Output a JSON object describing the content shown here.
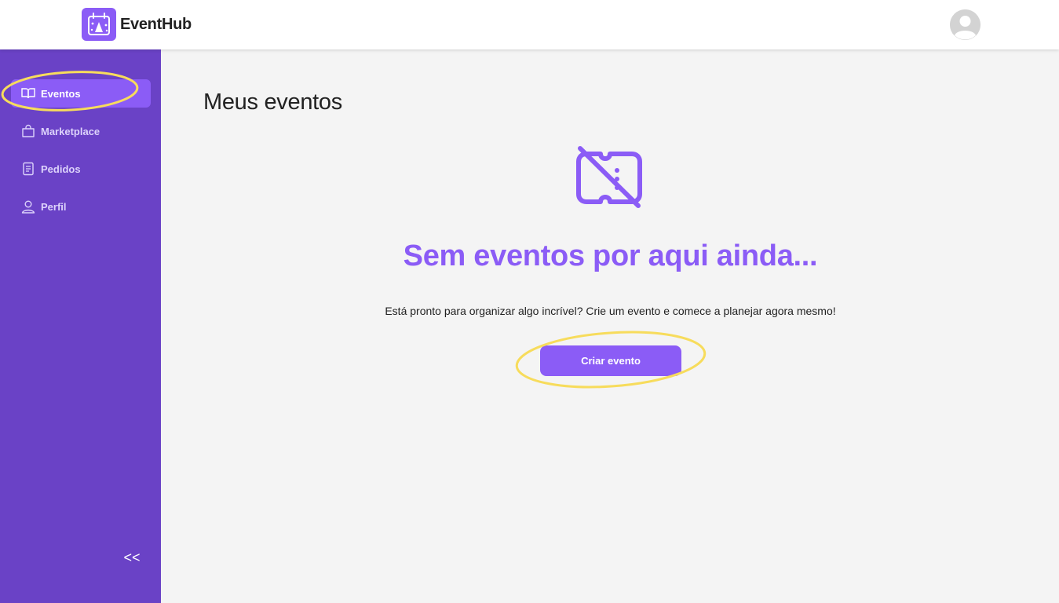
{
  "app": {
    "name": "EventHub",
    "logo_icon": "calendar-party-icon",
    "accent_color": "#8b5cf6",
    "sidebar_color": "#6a42c6",
    "highlight_color": "#f7dc5c"
  },
  "header": {
    "avatar_icon": "user-avatar-icon"
  },
  "sidebar": {
    "items": [
      {
        "label": "Eventos",
        "icon": "book-open-icon",
        "active": true
      },
      {
        "label": "Marketplace",
        "icon": "shopping-bag-icon",
        "active": false
      },
      {
        "label": "Pedidos",
        "icon": "receipt-icon",
        "active": false
      },
      {
        "label": "Perfil",
        "icon": "user-icon",
        "active": false
      }
    ],
    "collapse_label": "<<"
  },
  "main": {
    "title": "Meus eventos",
    "empty_state": {
      "icon": "ticket-off-icon",
      "title": "Sem eventos por aqui ainda...",
      "description": "Está pronto para organizar algo incrível? Crie um evento e comece a planejar agora mesmo!",
      "button_label": "Criar evento"
    }
  }
}
